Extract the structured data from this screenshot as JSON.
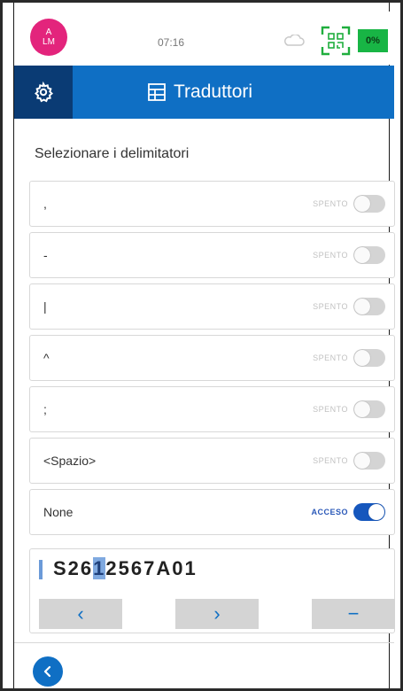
{
  "status_bar": {
    "avatar_line1": "A",
    "avatar_line2": "LM",
    "time": "07:16",
    "battery": "0%",
    "icons": [
      "cloud-icon",
      "qr-scan-icon"
    ]
  },
  "header": {
    "title": "Traduttori",
    "settings_icon": "gear-icon",
    "title_icon": "translator-icon"
  },
  "section_title": "Selezionare i delimitatori",
  "delimiters": [
    {
      "label": ",",
      "state": "SPENTO",
      "on": false
    },
    {
      "label": "-",
      "state": "SPENTO",
      "on": false
    },
    {
      "label": "|",
      "state": "SPENTO",
      "on": false
    },
    {
      "label": "^",
      "state": "SPENTO",
      "on": false
    },
    {
      "label": ";",
      "state": "SPENTO",
      "on": false
    },
    {
      "label": "<Spazio>",
      "state": "SPENTO",
      "on": false
    },
    {
      "label": "None",
      "state": "ACCESO",
      "on": true
    }
  ],
  "preview": {
    "text_before": "S26",
    "text_cursor": "1",
    "text_after": "2567A01"
  },
  "buttons": {
    "prev": "‹",
    "next": "›",
    "delete": "−",
    "back_icon": "chevron-left-icon"
  },
  "colors": {
    "primary": "#0f6fc4",
    "header_dark": "#0a3b74",
    "avatar": "#e3247c",
    "battery": "#18b545",
    "toggle_on": "#1657bd"
  }
}
